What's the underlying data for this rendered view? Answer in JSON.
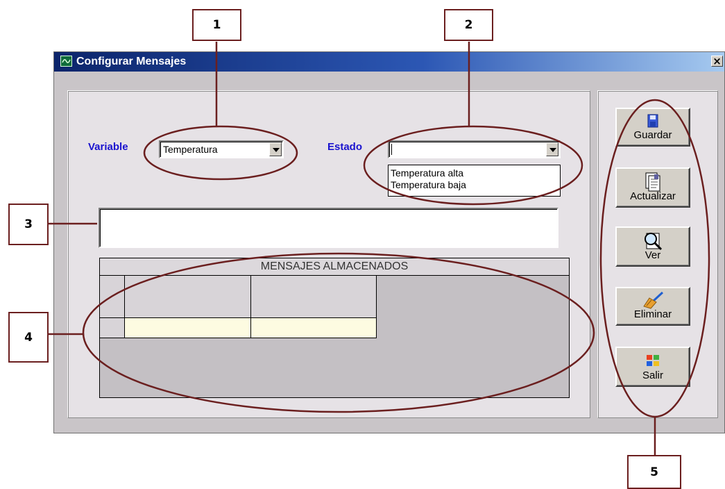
{
  "window": {
    "title": "Configurar Mensajes",
    "close_label": "×"
  },
  "form": {
    "variable_label": "Variable",
    "variable_value": "Temperatura",
    "estado_label": "Estado",
    "estado_value": "",
    "estado_options": [
      "Temperatura alta",
      "Temperatura baja"
    ],
    "message_value": ""
  },
  "grid": {
    "title": "MENSAJES ALMACENADOS",
    "columns": [
      "",
      ""
    ],
    "rows": [
      [
        "",
        ""
      ]
    ]
  },
  "toolbar": {
    "guardar": "Guardar",
    "actualizar": "Actualizar",
    "ver": "Ver",
    "eliminar": "Eliminar",
    "salir": "Salir"
  },
  "callouts": [
    "1",
    "2",
    "3",
    "4",
    "5"
  ],
  "colors": {
    "annotation": "#6b1f1f",
    "label_blue": "#1a13cf",
    "titlebar": "#0b246a"
  }
}
